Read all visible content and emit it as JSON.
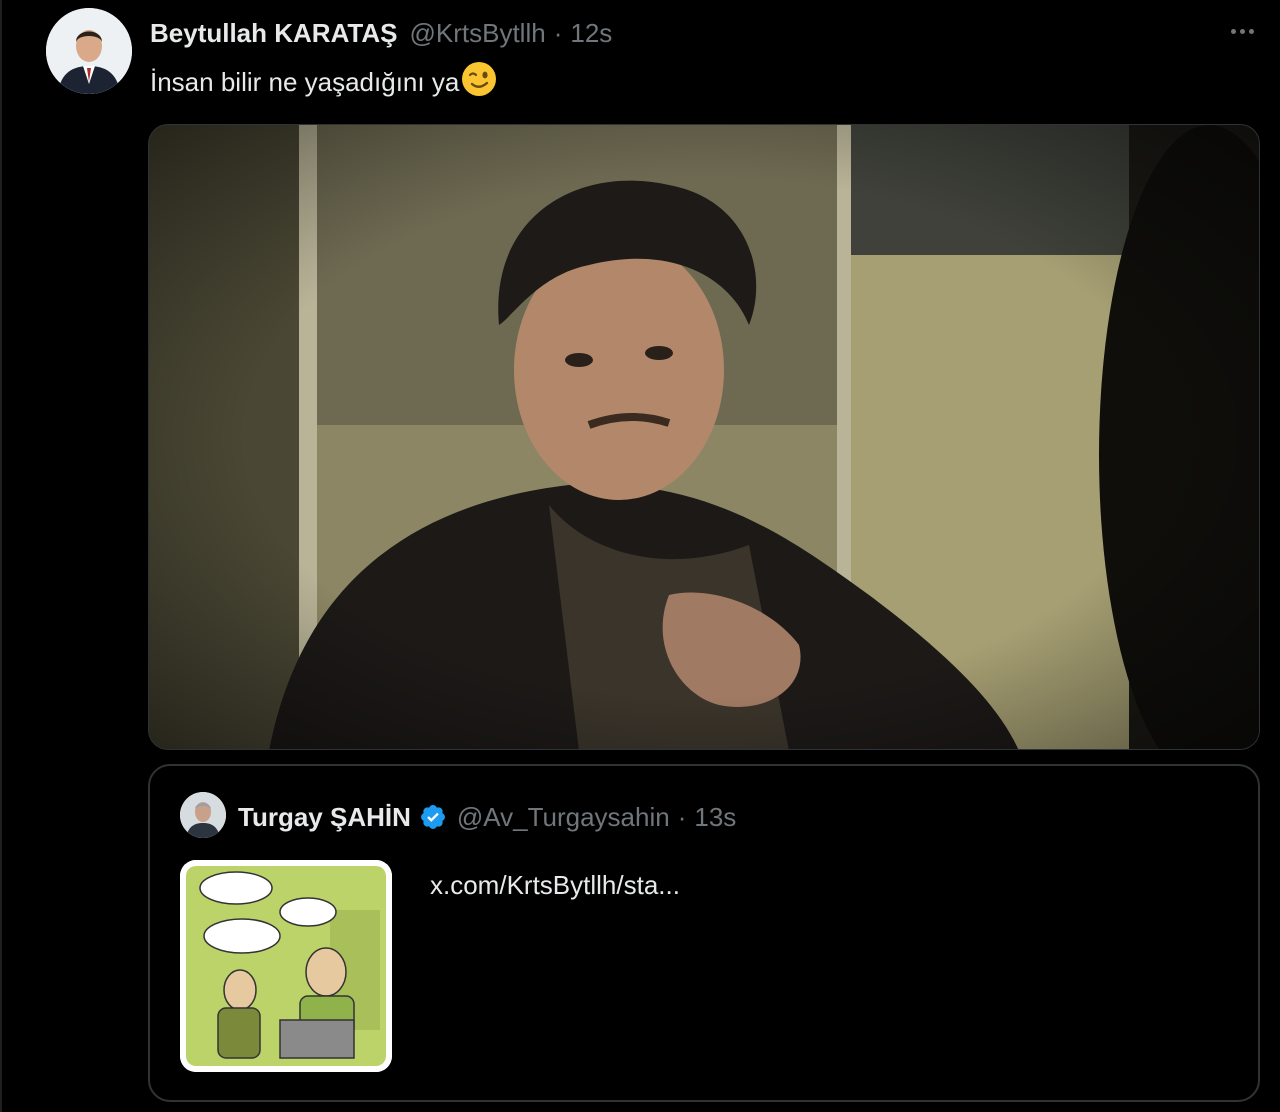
{
  "tweet": {
    "display_name": "Beytullah KARATAŞ",
    "handle": "@KrtsBytllh",
    "separator": "·",
    "time": "12s",
    "text": "İnsan bilir ne yaşadığını ya",
    "emoji": "😉"
  },
  "quote": {
    "display_name": "Turgay ŞAHİN",
    "handle": "@Av_Turgaysahin",
    "separator": "·",
    "time": "13s",
    "link_text": "x.com/KrtsBytllh/sta..."
  },
  "colors": {
    "background": "#000000",
    "text_primary": "#e7e9ea",
    "text_secondary": "#71767b",
    "border": "#2f3336",
    "verified_blue": "#1d9bf0"
  },
  "icons": [
    "more-options-icon",
    "verified-badge-icon"
  ]
}
